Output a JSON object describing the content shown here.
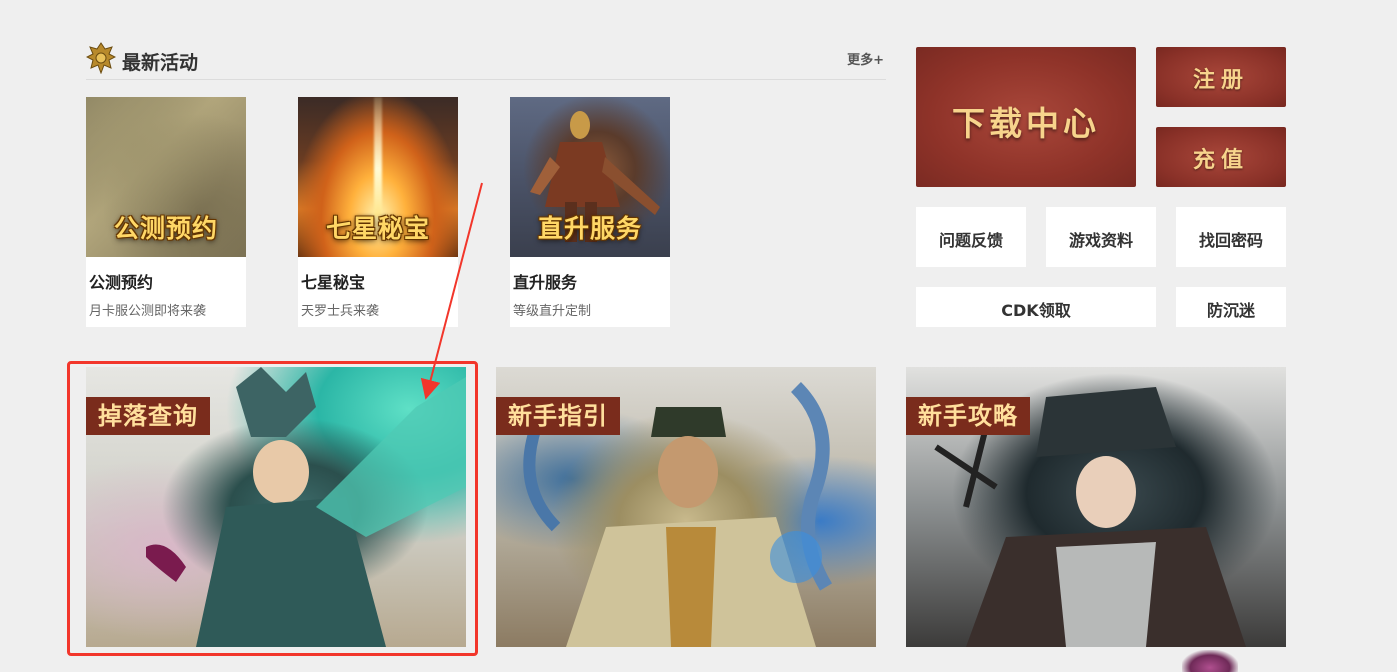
{
  "section": {
    "title": "最新活动",
    "more_label": "更多+"
  },
  "cards": [
    {
      "image_text": "公测预约",
      "title": "公测预约",
      "desc": "月卡服公测即将来袭"
    },
    {
      "image_text": "七星秘宝",
      "title": "七星秘宝",
      "desc": "天罗士兵来袭"
    },
    {
      "image_text": "直升服务",
      "title": "直升服务",
      "desc": "等级直升定制"
    }
  ],
  "side": {
    "download_label": "下载中心",
    "register_label": "注册",
    "recharge_label": "充值",
    "feedback_label": "问题反馈",
    "game_info_label": "游戏资料",
    "recover_password_label": "找回密码",
    "cdk_label": "CDK领取",
    "anti_addiction_label": "防沉迷"
  },
  "banners": [
    {
      "tag": "掉落查询"
    },
    {
      "tag": "新手指引"
    },
    {
      "tag": "新手攻略"
    }
  ],
  "colors": {
    "accent_red": "#8f3329",
    "label_gold": "#f7d48c",
    "annotation_red": "#f2362b"
  }
}
